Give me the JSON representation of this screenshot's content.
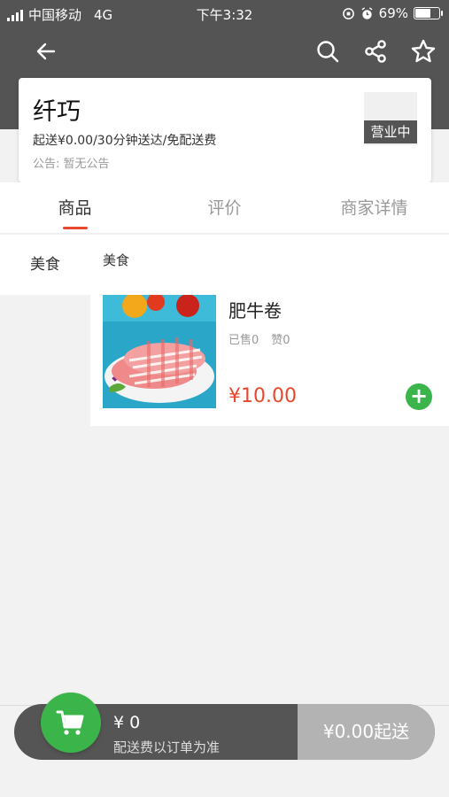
{
  "status_bar": {
    "carrier": "中国移动",
    "network": "4G",
    "time": "下午3:32",
    "battery": "69%",
    "battery_level": 0.69
  },
  "nav": {
    "back_icon": "arrow-left-icon",
    "search_icon": "search-icon",
    "share_icon": "share-icon",
    "favorite_icon": "star-icon"
  },
  "store": {
    "name": "纤巧",
    "info": "起送¥0.00/30分钟送达/免配送费",
    "notice": "公告: 暂无公告",
    "status": "营业中"
  },
  "tabs": [
    {
      "label": "商品",
      "active": true
    },
    {
      "label": "评价",
      "active": false
    },
    {
      "label": "商家详情",
      "active": false
    }
  ],
  "categories": [
    {
      "label": "美食"
    }
  ],
  "section_title": "美食",
  "products": [
    {
      "name": "肥牛卷",
      "sold": "已售0",
      "likes": "赞0",
      "price": "¥10.00"
    }
  ],
  "cart": {
    "amount": "¥ 0",
    "delivery_note": "配送费以订单为准",
    "min_order": "¥0.00起送",
    "icon": "shopping-cart-icon"
  },
  "colors": {
    "header": "#545454",
    "accent": "#e8482e",
    "green": "#3bb44a"
  }
}
